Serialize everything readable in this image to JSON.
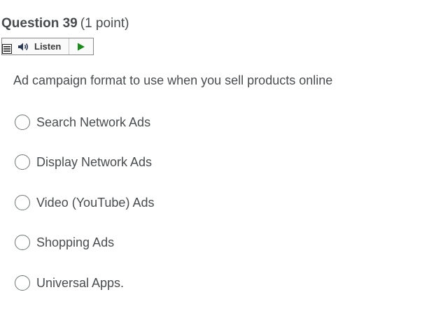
{
  "question": {
    "title": "Question 39",
    "points": "(1 point)",
    "text": "Ad campaign format to use when you sell products online"
  },
  "toolbar": {
    "menu_icon": "menu-icon",
    "speaker_icon": "speaker-icon",
    "listen_label": "Listen",
    "play_icon": "play-icon",
    "play_color": "#1a8a1a"
  },
  "options": [
    {
      "label": "Search Network Ads",
      "selected": false
    },
    {
      "label": "Display Network Ads",
      "selected": false
    },
    {
      "label": "Video (YouTube) Ads",
      "selected": false
    },
    {
      "label": "Shopping Ads",
      "selected": false
    },
    {
      "label": "Universal Apps.",
      "selected": false
    }
  ]
}
